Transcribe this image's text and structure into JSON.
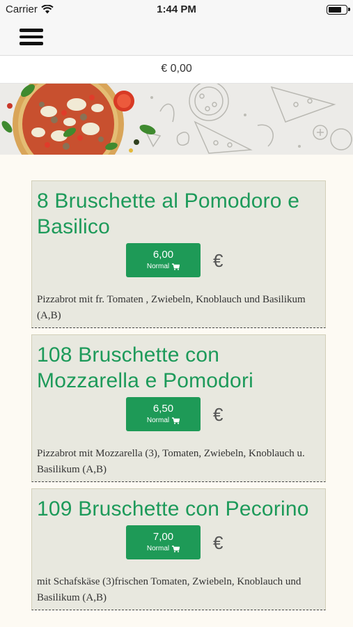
{
  "status_bar": {
    "carrier": "Carrier",
    "time": "1:44 PM",
    "battery_level": 0.8
  },
  "nav": {
    "menu_icon": "hamburger-menu-icon"
  },
  "cart": {
    "total": "€ 0,00"
  },
  "items": [
    {
      "title": "8 Bruschette al Pomodoro e Basilico",
      "price": "6,00",
      "size": "Normal",
      "currency": "€",
      "description": "Pizzabrot mit fr. Tomaten , Zwiebeln, Knoblauch und Basilikum (A,B)"
    },
    {
      "title": "108 Bruschette con Mozzarella e Pomodori",
      "price": "6,50",
      "size": "Normal",
      "currency": "€",
      "description": "Pizzabrot mit Mozzarella (3), Tomaten, Zwiebeln, Knoblauch u. Basilikum (A,B)"
    },
    {
      "title": "109 Bruschette con Pecorino",
      "price": "7,00",
      "size": "Normal",
      "currency": "€",
      "description": "mit Schafskäse (3)frischen Tomaten, Zwiebeln, Knoblauch und Basilikum (A,B)"
    }
  ],
  "colors": {
    "accent": "#1e9a57",
    "title": "#1d9a5a",
    "card": "#e8e8df",
    "background": "#fdfaf3"
  }
}
